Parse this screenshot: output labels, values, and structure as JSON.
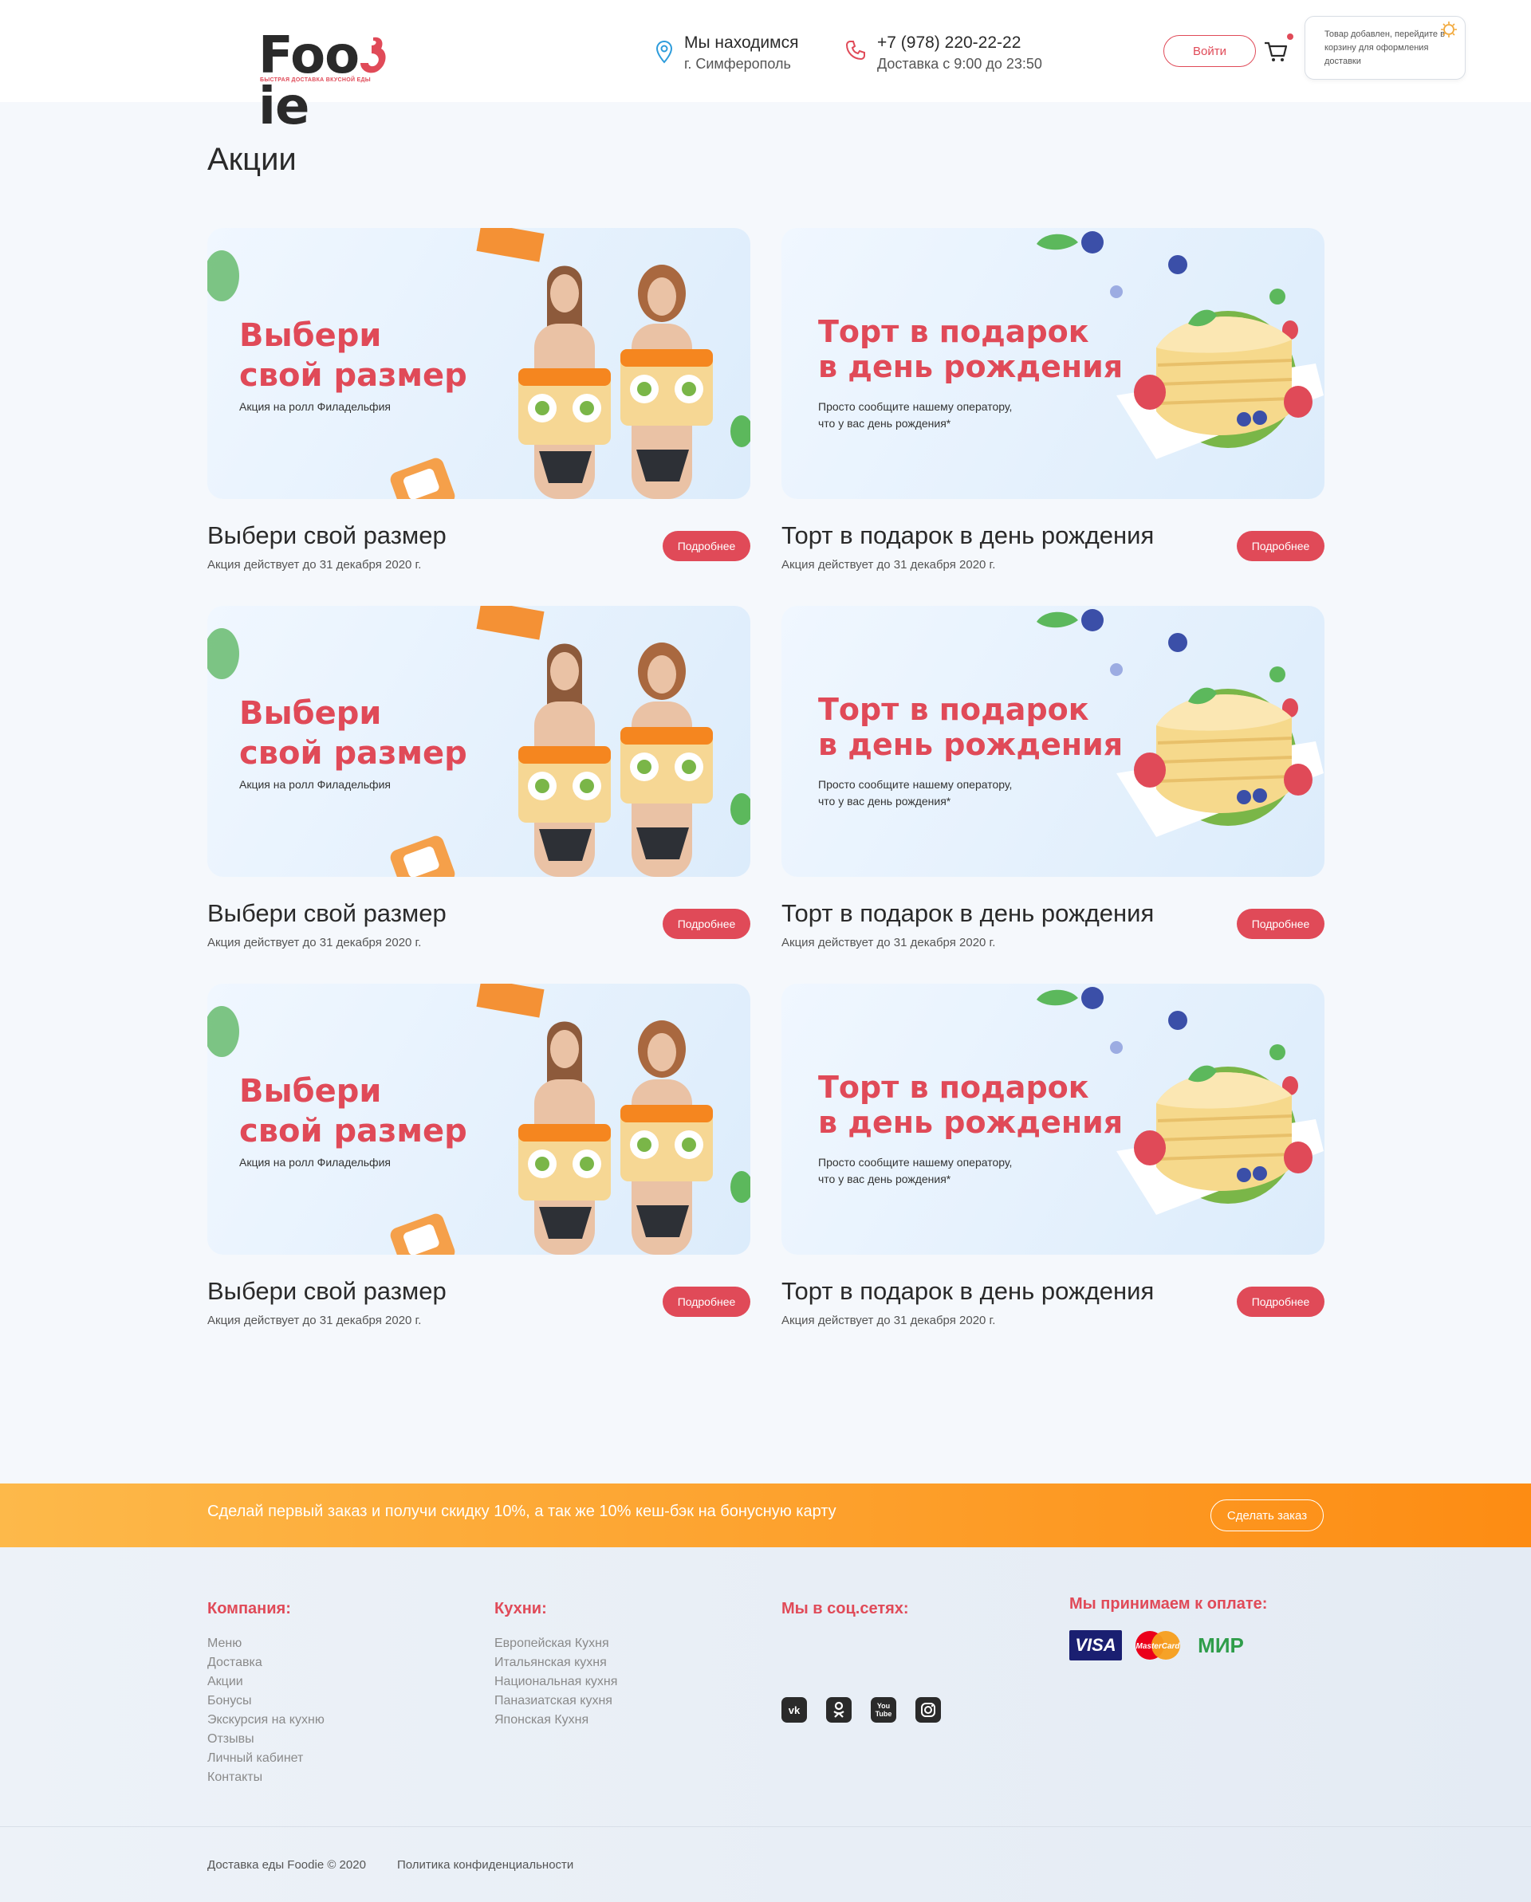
{
  "header": {
    "logo_text_left": "Foo",
    "logo_text_right": "ie",
    "logo_tagline": "БЫСТРАЯ ДОСТАВКА ВКУСНОЙ ЕДЫ",
    "location_title": "Мы находимся",
    "location_city": "г. Симферополь",
    "phone": "+7 (978) 220-22-22",
    "hours": "Доставка с 9:00 до 23:50",
    "login_label": "Войти",
    "toast_text": "Товар добавлен, перейдите в корзину для оформления доставки"
  },
  "page_title": "Акции",
  "promos": [
    {
      "banner_title": "Выбери\nсвой размер",
      "banner_sub": "Акция на ролл Филадельфия",
      "title": "Выбери свой размер",
      "date": "Акция действует до 31 декабря 2020 г.",
      "button": "Подробнее"
    },
    {
      "banner_title": "Торт в подарок\nв день рождения",
      "banner_sub": "Просто сообщите нашему оператору,\nчто у вас день рождения*",
      "title": "Торт в подарок в день рождения",
      "date": "Акция действует до 31 декабря 2020 г.",
      "button": "Подробнее"
    },
    {
      "banner_title": "Выбери\nсвой размер",
      "banner_sub": "Акция на ролл Филадельфия",
      "title": "Выбери свой размер",
      "date": "Акция действует до 31 декабря 2020 г.",
      "button": "Подробнее"
    },
    {
      "banner_title": "Торт в подарок\nв день рождения",
      "banner_sub": "Просто сообщите нашему оператору,\nчто у вас день рождения*",
      "title": "Торт в подарок в день рождения",
      "date": "Акция действует до 31 декабря 2020 г.",
      "button": "Подробнее"
    },
    {
      "banner_title": "Выбери\nсвой размер",
      "banner_sub": "Акция на ролл Филадельфия",
      "title": "Выбери свой размер",
      "date": "Акция действует до 31 декабря 2020 г.",
      "button": "Подробнее"
    },
    {
      "banner_title": "Торт в подарок\nв день рождения",
      "banner_sub": "Просто сообщите нашему оператору,\nчто у вас день рождения*",
      "title": "Торт в подарок в день рождения",
      "date": "Акция действует до 31 декабря 2020 г.",
      "button": "Подробнее"
    }
  ],
  "strip": {
    "text": "Сделай первый заказ и получи скидку 10%, а так же 10% кеш-бэк на бонусную карту",
    "button": "Сделать заказ"
  },
  "footer": {
    "company_head": "Компания:",
    "company_links": [
      "Меню",
      "Доставка",
      "Акции",
      "Бонусы",
      "Экскурсия на кухню",
      "Отзывы",
      "Личный кабинет",
      "Контакты"
    ],
    "kitchens_head": "Кухни:",
    "kitchens_links": [
      "Европейская Кухня",
      "Итальянская кухня",
      "Национальная кухня",
      "Паназиатская кухня",
      "Японская Кухня"
    ],
    "social_head": "Мы в соц.сетях:",
    "social": [
      "vk-icon",
      "odnoklassniki-icon",
      "youtube-icon",
      "instagram-icon"
    ],
    "payment_head": "Мы принимаем к оплате:",
    "payment": {
      "visa": "VISA",
      "mastercard": "MasterCard",
      "mir": "МИР"
    },
    "copyright": "Доставка еды Foodie © 2020",
    "privacy": "Политика конфиденциальности"
  },
  "colors": {
    "accent": "#e04a58",
    "strip_start": "#fdb94a",
    "strip_end": "#fd8c13",
    "bg": "#f5f8fc"
  }
}
